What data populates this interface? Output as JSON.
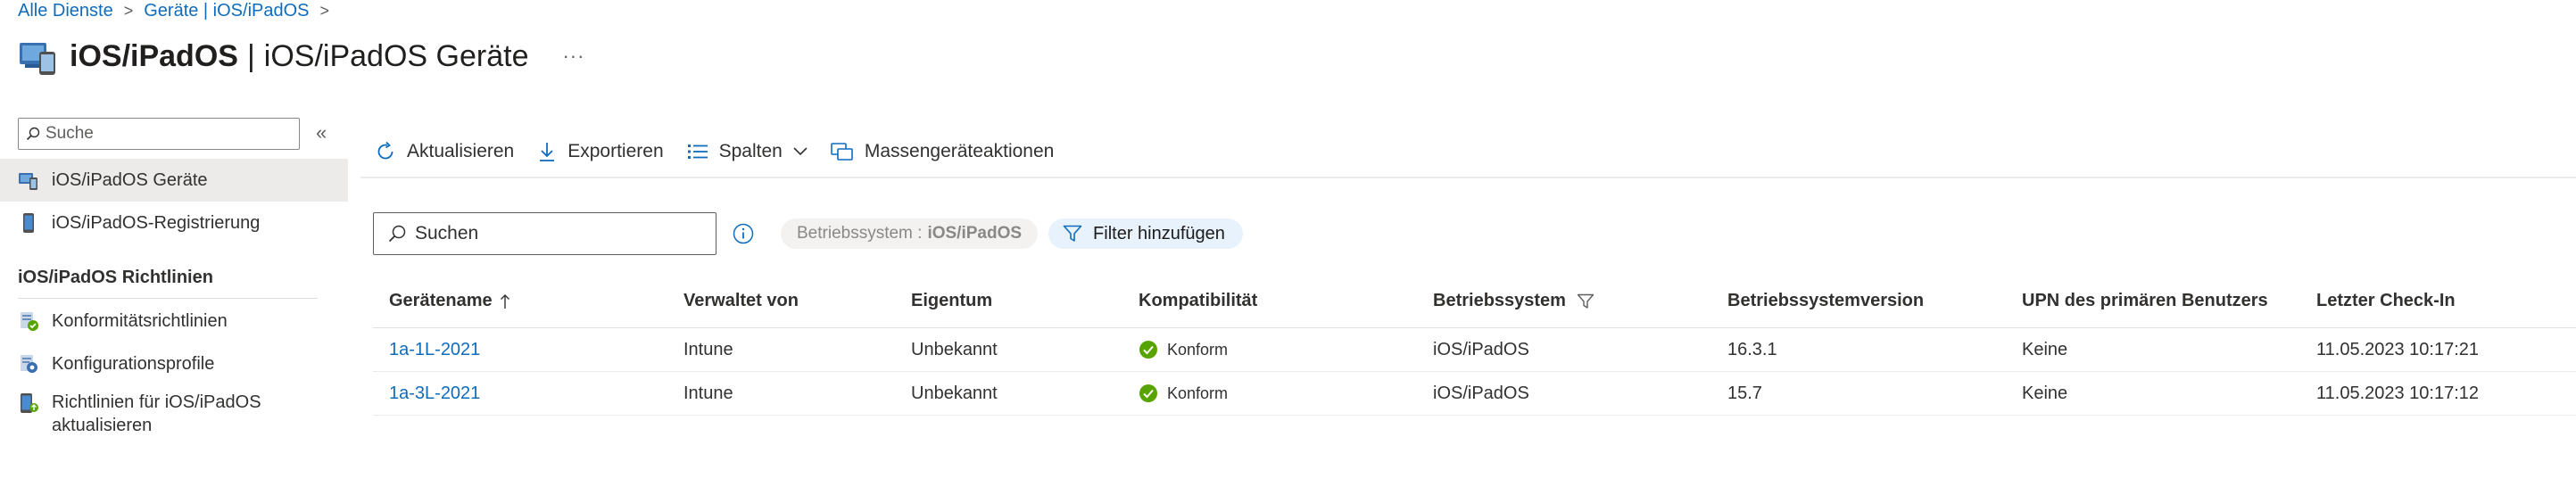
{
  "breadcrumb": {
    "items": [
      "Alle Dienste",
      "Geräte | iOS/iPadOS"
    ],
    "separator": ">"
  },
  "header": {
    "title_main": "iOS/iPadOS",
    "title_sep": "|",
    "title_sub": "iOS/iPadOS Geräte",
    "more": "···",
    "icon": "device-blade-icon"
  },
  "sidebar": {
    "search_placeholder": "Suche",
    "collapse": "«",
    "items": [
      {
        "label": "iOS/iPadOS Geräte",
        "icon": "devices-icon",
        "active": true
      },
      {
        "label": "iOS/iPadOS-Registrierung",
        "icon": "phone-icon",
        "active": false
      }
    ],
    "section_title": "iOS/iPadOS Richtlinien",
    "policy_items": [
      {
        "label": "Konformitätsrichtlinien",
        "icon": "compliance-icon"
      },
      {
        "label": "Konfigurationsprofile",
        "icon": "config-profile-icon"
      },
      {
        "label_line1": "Richtlinien für iOS/iPadOS",
        "label_line2": "aktualisieren",
        "icon": "update-policy-icon"
      }
    ]
  },
  "toolbar": {
    "refresh": "Aktualisieren",
    "export": "Exportieren",
    "columns": "Spalten",
    "bulk": "Massengeräteaktionen"
  },
  "filters": {
    "search_placeholder": "Suchen",
    "os_pill_label": "Betriebssystem :",
    "os_pill_value": "iOS/iPadOS",
    "add_filter": "Filter hinzufügen"
  },
  "table": {
    "columns": [
      "Gerätename",
      "Verwaltet von",
      "Eigentum",
      "Kompatibilität",
      "Betriebssystem",
      "Betriebssystemversion",
      "UPN des primären Benutzers",
      "Letzter Check-In"
    ],
    "rows": [
      {
        "name": "1a-1L-2021",
        "managed_by": "Intune",
        "ownership": "Unbekannt",
        "compliance": "Konform",
        "os": "iOS/iPadOS",
        "os_version": "16.3.1",
        "upn": "Keine",
        "last_checkin": "11.05.2023 10:17:21"
      },
      {
        "name": "1a-3L-2021",
        "managed_by": "Intune",
        "ownership": "Unbekannt",
        "compliance": "Konform",
        "os": "iOS/iPadOS",
        "os_version": "15.7",
        "upn": "Keine",
        "last_checkin": "11.05.2023 10:17:12"
      }
    ]
  },
  "colors": {
    "accent": "#0f6cbd",
    "compliant": "#107c10",
    "active_nav": "#edebe9"
  }
}
